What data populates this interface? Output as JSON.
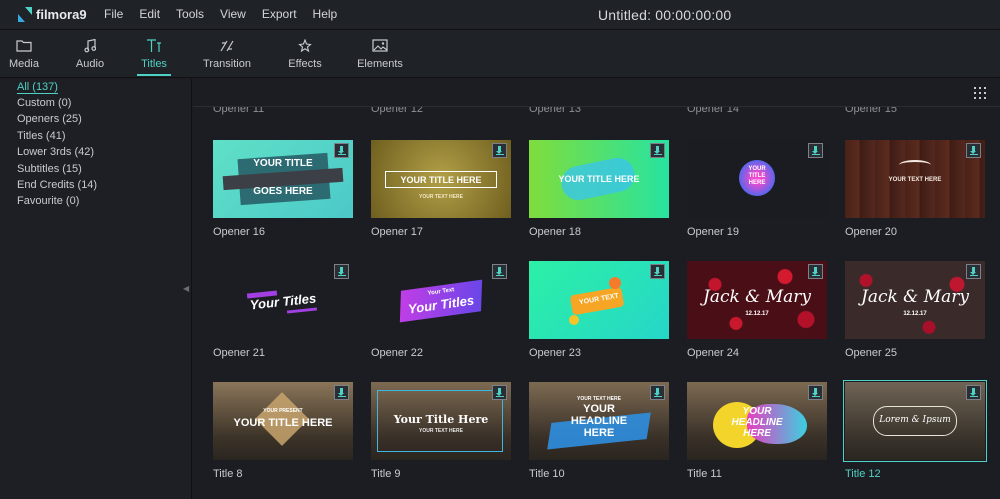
{
  "app": {
    "logo_text": "filmora9",
    "menu": [
      "File",
      "Edit",
      "Tools",
      "View",
      "Export",
      "Help"
    ],
    "project_title": "Untitled:  00:00:00:00"
  },
  "tabs": [
    {
      "label": "Media",
      "icon": "folder-icon",
      "active": false
    },
    {
      "label": "Audio",
      "icon": "music-note-icon",
      "active": false
    },
    {
      "label": "Titles",
      "icon": "text-icon",
      "active": true
    },
    {
      "label": "Transition",
      "icon": "transition-icon",
      "active": false
    },
    {
      "label": "Effects",
      "icon": "effects-sparkle-icon",
      "active": false
    },
    {
      "label": "Elements",
      "icon": "image-icon",
      "active": false
    }
  ],
  "categories": [
    {
      "label": "All (137)",
      "active": true
    },
    {
      "label": "Custom (0)",
      "active": false
    },
    {
      "label": "Openers (25)",
      "active": false
    },
    {
      "label": "Titles (41)",
      "active": false
    },
    {
      "label": "Lower 3rds (42)",
      "active": false
    },
    {
      "label": "Subtitles (15)",
      "active": false
    },
    {
      "label": "End Credits (14)",
      "active": false
    },
    {
      "label": "Favourite (0)",
      "active": false
    }
  ],
  "partial_row": [
    "Opener 11",
    "Opener 12",
    "Opener 13",
    "Opener 14",
    "Opener 15"
  ],
  "rows": [
    [
      {
        "name": "Opener 16",
        "thumb_text": [
          "YOUR TITLE",
          "GOES HERE"
        ]
      },
      {
        "name": "Opener 17",
        "thumb_text": [
          "YOUR TITLE HERE",
          "YOUR TEXT HERE"
        ]
      },
      {
        "name": "Opener 18",
        "thumb_text": [
          "YOUR TITLE HERE"
        ]
      },
      {
        "name": "Opener 19",
        "thumb_text": [
          "YOUR",
          "TITLE",
          "HERE"
        ]
      },
      {
        "name": "Opener 20",
        "thumb_text": [
          "YOUR TEXT HERE"
        ]
      }
    ],
    [
      {
        "name": "Opener 21",
        "thumb_text": [
          "Your Titles"
        ]
      },
      {
        "name": "Opener 22",
        "thumb_text": [
          "Your Text",
          "Your Titles"
        ]
      },
      {
        "name": "Opener 23",
        "thumb_text": [
          "YOUR TEXT"
        ]
      },
      {
        "name": "Opener 24",
        "thumb_text": [
          "Jack & Mary",
          "12.12.17"
        ]
      },
      {
        "name": "Opener 25",
        "thumb_text": [
          "Jack & Mary",
          "12.12.17"
        ]
      }
    ],
    [
      {
        "name": "Title 8",
        "thumb_text": [
          "YOUR PRESENT",
          "YOUR TITLE HERE"
        ]
      },
      {
        "name": "Title 9",
        "thumb_text": [
          "Your Title Here",
          "YOUR TEXT HERE"
        ]
      },
      {
        "name": "Title 10",
        "thumb_text": [
          "YOUR TEXT HERE",
          "YOUR",
          "HEADLINE",
          "HERE"
        ]
      },
      {
        "name": "Title 11",
        "thumb_text": [
          "YOUR",
          "HEADLINE",
          "HERE"
        ]
      },
      {
        "name": "Title 12",
        "thumb_text": [
          "Lorem & Ipsum"
        ],
        "selected": true
      }
    ]
  ],
  "colors": {
    "accent": "#4fd1c5",
    "background": "#1b1d22",
    "panel": "#1f2227"
  }
}
